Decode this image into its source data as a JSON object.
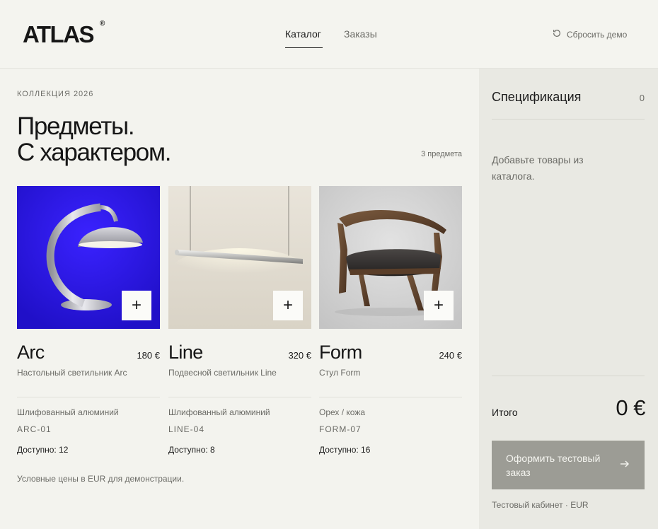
{
  "header": {
    "logo": "ATLAS",
    "logo_mark": "®",
    "nav": [
      {
        "label": "Каталог",
        "active": true
      },
      {
        "label": "Заказы",
        "active": false
      }
    ],
    "reset_label": "Сбросить демо"
  },
  "catalog": {
    "eyebrow": "КОЛЛЕКЦИЯ 2026",
    "headline_line1": "Предметы.",
    "headline_line2": "С характером.",
    "count": "3 предмета",
    "products": [
      {
        "name": "Arc",
        "price": "180 €",
        "description": "Настольный светильник Arc",
        "material": "Шлифованный алюминий",
        "sku": "ARC-01",
        "stock": "Доступно: 12",
        "add_label": "+"
      },
      {
        "name": "Line",
        "price": "320 €",
        "description": "Подвесной светильник Line",
        "material": "Шлифованный алюминий",
        "sku": "LINE-04",
        "stock": "Доступно: 8",
        "add_label": "+"
      },
      {
        "name": "Form",
        "price": "240 €",
        "description": "Стул Form",
        "material": "Орех / кожа",
        "sku": "FORM-07",
        "stock": "Доступно: 16",
        "add_label": "+"
      }
    ],
    "footnote": "Условные цены в EUR для демонстрации."
  },
  "sidebar": {
    "title": "Спецификация",
    "count": "0",
    "empty_text": "Добавьте товары из каталога.",
    "total_label": "Итого",
    "total_value": "0 €",
    "checkout_label": "Оформить тестовый заказ",
    "cabinet": "Тестовый кабинет · EUR"
  },
  "colors": {
    "page_bg": "#f3f3ee",
    "sidebar_bg": "#e9e9e3",
    "checkout_bg": "#9c9c95",
    "arc_bg": "#2a14d8"
  }
}
